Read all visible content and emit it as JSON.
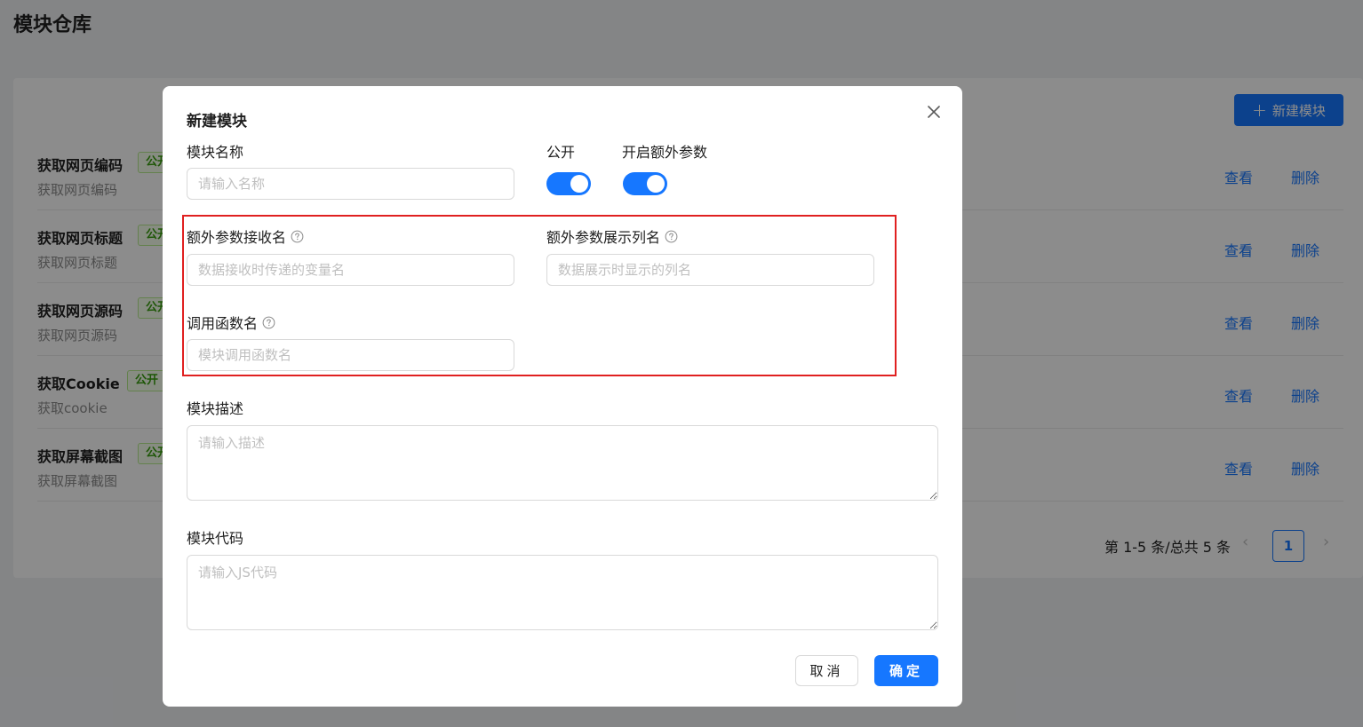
{
  "page": {
    "title": "模块仓库",
    "new_button_label": "新建模块",
    "rows": [
      {
        "name": "获取网页编码",
        "tag": "公开",
        "desc": "获取网页编码",
        "view": "查看",
        "delete": "删除"
      },
      {
        "name": "获取网页标题",
        "tag": "公开",
        "desc": "获取网页标题",
        "view": "查看",
        "delete": "删除"
      },
      {
        "name": "获取网页源码",
        "tag": "公开",
        "desc": "获取网页源码",
        "view": "查看",
        "delete": "删除"
      },
      {
        "name": "获取Cookie",
        "tag": "公开",
        "desc": "获取cookie",
        "view": "查看",
        "delete": "删除"
      },
      {
        "name": "获取屏幕截图",
        "tag": "公开",
        "desc": "获取屏幕截图",
        "view": "查看",
        "delete": "删除"
      }
    ],
    "pagination": {
      "summary": "第 1-5 条/总共 5 条",
      "current": "1",
      "prev": "‹",
      "next": "›"
    }
  },
  "modal": {
    "title": "新建模块",
    "close_icon": "close-icon",
    "name_label": "模块名称",
    "name_placeholder": "请输入名称",
    "public_label": "公开",
    "public_on": true,
    "extra_label": "开启额外参数",
    "extra_on": true,
    "param_receive_label": "额外参数接收名",
    "param_receive_placeholder": "数据接收时传递的变量名",
    "param_display_label": "额外参数展示列名",
    "param_display_placeholder": "数据展示时显示的列名",
    "func_label": "调用函数名",
    "func_placeholder": "模块调用函数名",
    "desc_label": "模块描述",
    "desc_placeholder": "请输入描述",
    "code_label": "模块代码",
    "code_placeholder": "请输入JS代码",
    "cancel_label": "取消",
    "ok_label": "确定"
  },
  "colors": {
    "primary": "#1677ff",
    "highlight": "#e02020",
    "tag_green": "#389e0d"
  }
}
